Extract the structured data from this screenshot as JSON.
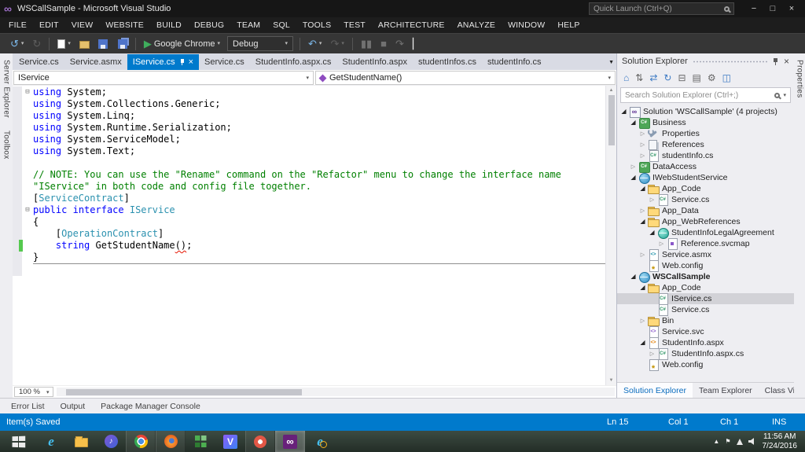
{
  "titlebar": {
    "title": "WSCallSample - Microsoft Visual Studio",
    "quick_launch_placeholder": "Quick Launch (Ctrl+Q)",
    "window_buttons": [
      {
        "name": "minimize-button",
        "glyph": "−"
      },
      {
        "name": "maximize-button",
        "glyph": "□"
      },
      {
        "name": "close-button",
        "glyph": "×"
      }
    ]
  },
  "menubar": {
    "items": [
      "FILE",
      "EDIT",
      "VIEW",
      "WEBSITE",
      "BUILD",
      "DEBUG",
      "TEAM",
      "SQL",
      "TOOLS",
      "TEST",
      "ARCHITECTURE",
      "ANALYZE",
      "WINDOW",
      "HELP"
    ]
  },
  "icons": {
    "back-icon": {
      "glyph": "↺",
      "color": "#7cb8ea"
    },
    "forward-icon": {
      "glyph": "↻",
      "color": "#9a9a9a"
    },
    "play-icon": {
      "glyph": "▶",
      "color": "#3fae5c"
    },
    "undo-icon": {
      "glyph": "↶",
      "color": "#7cb8ea"
    },
    "redo-icon": {
      "glyph": "↷",
      "color": "#9a9a9a"
    },
    "pause-icon": {
      "glyph": "▮▮",
      "color": "#c9c9c9"
    },
    "stop-icon": {
      "glyph": "■",
      "color": "#c9c9c9"
    },
    "step-icon": {
      "glyph": "↷",
      "color": "#c9c9c9"
    },
    "cursor-icon": {
      "glyph": "▏",
      "color": "#e8e8e8"
    }
  },
  "toolbar": {
    "items": [
      {
        "kind": "btn",
        "name": "navigate-backward-button",
        "icon": "back-icon",
        "caret": true
      },
      {
        "kind": "btn",
        "name": "navigate-forward-button",
        "icon": "forward-icon",
        "dim": true
      },
      {
        "kind": "sep"
      },
      {
        "kind": "btn",
        "name": "new-file-button",
        "icon": "new-file-icon",
        "caret": true
      },
      {
        "kind": "btn",
        "name": "open-file-button",
        "icon": "open-file-icon"
      },
      {
        "kind": "btn",
        "name": "save-button",
        "icon": "save-icon"
      },
      {
        "kind": "btn",
        "name": "save-all-button",
        "icon": "save-all-icon"
      },
      {
        "kind": "sep"
      },
      {
        "kind": "btn",
        "name": "start-debug-button",
        "icon": "play-icon",
        "label": "Google Chrome",
        "caret": true
      },
      {
        "kind": "combo",
        "name": "solution-configuration-dropdown",
        "label": "Debug"
      },
      {
        "kind": "sep"
      },
      {
        "kind": "btn",
        "name": "undo-button",
        "icon": "undo-icon",
        "caret": true
      },
      {
        "kind": "btn",
        "name": "redo-button",
        "icon": "redo-icon",
        "caret": true,
        "dim": true
      },
      {
        "kind": "sep"
      },
      {
        "kind": "btn",
        "name": "break-all-button",
        "icon": "pause-icon",
        "dim": true
      },
      {
        "kind": "btn",
        "name": "stop-debug-button",
        "icon": "stop-icon",
        "dim": true
      },
      {
        "kind": "btn",
        "name": "step-over-button",
        "icon": "step-icon",
        "dim": true
      },
      {
        "kind": "btn",
        "name": "text-cursor-button",
        "icon": "cursor-icon"
      }
    ]
  },
  "left_strip": {
    "tabs": [
      "Server Explorer",
      "Toolbox"
    ]
  },
  "right_strip": {
    "tabs": [
      "Properties"
    ]
  },
  "editor_tabs": [
    {
      "label": "Service.cs",
      "active": false
    },
    {
      "label": "Service.asmx",
      "active": false
    },
    {
      "label": "IService.cs",
      "active": true
    },
    {
      "label": "Service.cs",
      "active": false
    },
    {
      "label": "StudentInfo.aspx.cs",
      "active": false
    },
    {
      "label": "StudentInfo.aspx",
      "active": false
    },
    {
      "label": "studentInfos.cs",
      "active": false
    },
    {
      "label": "studentInfo.cs",
      "active": false
    }
  ],
  "navbar": {
    "type_name": "IService",
    "member_name": "GetStudentName()"
  },
  "code": {
    "lines": [
      {
        "fold": true,
        "tokens": [
          [
            "kw",
            "using"
          ],
          [
            "pl",
            " System;"
          ]
        ]
      },
      {
        "tokens": [
          [
            "kw",
            "using"
          ],
          [
            "pl",
            " System.Collections.Generic;"
          ]
        ]
      },
      {
        "tokens": [
          [
            "kw",
            "using"
          ],
          [
            "pl",
            " System.Linq;"
          ]
        ]
      },
      {
        "tokens": [
          [
            "kw",
            "using"
          ],
          [
            "pl",
            " System.Runtime.Serialization;"
          ]
        ]
      },
      {
        "tokens": [
          [
            "kw",
            "using"
          ],
          [
            "pl",
            " System.ServiceModel;"
          ]
        ]
      },
      {
        "tokens": [
          [
            "kw",
            "using"
          ],
          [
            "pl",
            " System.Text;"
          ]
        ]
      },
      {
        "tokens": []
      },
      {
        "tokens": [
          [
            "cm",
            "// NOTE: You can use the \"Rename\" command on the \"Refactor\" menu to change the interface name \"IService\" in both code and config file together."
          ]
        ]
      },
      {
        "tokens": [
          [
            "pl",
            "["
          ],
          [
            "ty",
            "ServiceContract"
          ],
          [
            "pl",
            "]"
          ]
        ]
      },
      {
        "fold": true,
        "tokens": [
          [
            "kw",
            "public"
          ],
          [
            "pl",
            " "
          ],
          [
            "kw",
            "interface"
          ],
          [
            "pl",
            " "
          ],
          [
            "ty",
            "IService"
          ]
        ]
      },
      {
        "tokens": [
          [
            "pl",
            "{"
          ]
        ]
      },
      {
        "tokens": [
          [
            "pl",
            "    ["
          ],
          [
            "ty",
            "OperationContract"
          ],
          [
            "pl",
            "]"
          ]
        ]
      },
      {
        "changed": true,
        "tokens": [
          [
            "pl",
            "    "
          ],
          [
            "kw",
            "string"
          ],
          [
            "pl",
            " GetStudentName"
          ],
          [
            "sq",
            "()"
          ],
          [
            "pl",
            ";"
          ]
        ]
      },
      {
        "tokens": [
          [
            "pl",
            "}"
          ]
        ]
      },
      {
        "hr": true,
        "tokens": []
      }
    ]
  },
  "zoom_level": "100 %",
  "bottom_panel_tabs": [
    "Error List",
    "Output",
    "Package Manager Console"
  ],
  "solution_explorer": {
    "title": "Solution Explorer",
    "search_placeholder": "Search Solution Explorer (Ctrl+;)",
    "toolbar_icons": [
      {
        "name": "home-icon",
        "glyph": "⌂",
        "color": "#3e7bc4"
      },
      {
        "name": "switch-views-icon",
        "glyph": "⇅",
        "color": "#666666"
      },
      {
        "name": "sync-with-active-document-icon",
        "glyph": "⇄",
        "color": "#3e7bc4"
      },
      {
        "name": "refresh-icon",
        "glyph": "↻",
        "color": "#3e7bc4"
      },
      {
        "name": "collapse-all-icon",
        "glyph": "⊟",
        "color": "#666666"
      },
      {
        "name": "show-all-files-icon",
        "glyph": "▤",
        "color": "#666666"
      },
      {
        "name": "properties-icon",
        "glyph": "⚙",
        "color": "#666666"
      },
      {
        "name": "preview-selected-items-icon",
        "glyph": "◫",
        "color": "#3e7bc4"
      }
    ],
    "tree": [
      {
        "level": 0,
        "arrow": "exp",
        "icon": "solution-icon",
        "label": "Solution 'WSCallSample' (4 projects)"
      },
      {
        "level": 1,
        "arrow": "exp",
        "icon": "csproj-icon",
        "label": "Business"
      },
      {
        "level": 2,
        "arrow": "col",
        "icon": "properties-node-icon",
        "label": "Properties"
      },
      {
        "level": 2,
        "arrow": "col",
        "icon": "references-icon",
        "label": "References"
      },
      {
        "level": 2,
        "arrow": "col",
        "icon": "csharp-file-icon",
        "label": "studentInfo.cs"
      },
      {
        "level": 1,
        "arrow": "col",
        "icon": "csproj-icon",
        "label": "DataAccess"
      },
      {
        "level": 1,
        "arrow": "exp",
        "icon": "web-project-icon",
        "label": "IWebStudentService"
      },
      {
        "level": 2,
        "arrow": "exp",
        "icon": "folder-icon",
        "label": "App_Code"
      },
      {
        "level": 3,
        "arrow": "col",
        "icon": "csharp-file-icon",
        "label": "Service.cs"
      },
      {
        "level": 2,
        "arrow": "col",
        "icon": "folder-icon",
        "label": "App_Data"
      },
      {
        "level": 2,
        "arrow": "exp",
        "icon": "folder-icon",
        "label": "App_WebReferences"
      },
      {
        "level": 3,
        "arrow": "exp",
        "icon": "web-reference-icon",
        "label": "StudentInfoLegalAgreement"
      },
      {
        "level": 4,
        "arrow": "col",
        "icon": "svcmap-file-icon",
        "label": "Reference.svcmap"
      },
      {
        "level": 2,
        "arrow": "col",
        "icon": "asmx-file-icon",
        "label": "Service.asmx"
      },
      {
        "level": 2,
        "icon": "config-file-icon",
        "label": "Web.config"
      },
      {
        "level": 1,
        "arrow": "exp",
        "icon": "web-project-icon",
        "label": "WSCallSample",
        "bold": true
      },
      {
        "level": 2,
        "arrow": "exp",
        "icon": "folder-icon",
        "label": "App_Code"
      },
      {
        "level": 3,
        "icon": "csharp-file-icon",
        "label": "IService.cs",
        "selected": true
      },
      {
        "level": 3,
        "icon": "csharp-file-icon",
        "label": "Service.cs"
      },
      {
        "level": 2,
        "arrow": "col",
        "icon": "folder-icon",
        "label": "Bin"
      },
      {
        "level": 2,
        "icon": "svc-file-icon",
        "label": "Service.svc"
      },
      {
        "level": 2,
        "arrow": "exp",
        "icon": "aspx-file-icon",
        "label": "StudentInfo.aspx"
      },
      {
        "level": 3,
        "arrow": "col",
        "icon": "csharp-file-icon",
        "label": "StudentInfo.aspx.cs"
      },
      {
        "level": 2,
        "icon": "config-file-icon",
        "label": "Web.config"
      }
    ],
    "footer_tabs": [
      {
        "label": "Solution Explorer",
        "active": true
      },
      {
        "label": "Team Explorer",
        "active": false
      },
      {
        "label": "Class View",
        "active": false
      }
    ]
  },
  "statusbar": {
    "message": "Item(s) Saved",
    "line": "Ln 15",
    "column": "Col 1",
    "character": "Ch 1",
    "mode": "INS"
  },
  "taskbar": {
    "apps": [
      {
        "name": "internet-explorer-icon",
        "state": ""
      },
      {
        "name": "file-explorer-icon",
        "state": ""
      },
      {
        "name": "media-app-icon",
        "state": ""
      },
      {
        "name": "chrome-icon",
        "state": "running"
      },
      {
        "name": "firefox-icon",
        "state": "running"
      },
      {
        "name": "green-grid-app-icon",
        "state": ""
      },
      {
        "name": "v-app-icon",
        "state": ""
      },
      {
        "name": "browser-app-icon",
        "state": "running"
      },
      {
        "name": "visual-studio-icon",
        "state": "active"
      },
      {
        "name": "ie-tools-icon",
        "state": ""
      }
    ],
    "tray_icons": [
      {
        "name": "show-hidden-icons-icon",
        "glyph": "▲"
      },
      {
        "name": "action-center-icon",
        "glyph": "⚑"
      },
      {
        "name": "network-icon",
        "glyph": ""
      },
      {
        "name": "volume-icon",
        "glyph": ""
      }
    ],
    "clock_time": "11:56 AM",
    "clock_date": "7/24/2016"
  },
  "colors": {
    "accent": "#007acc",
    "keyword": "#0000ff",
    "type_name": "#2b91af",
    "comment": "#008000",
    "selection": "#d2d2d7",
    "status_bar": "#007acc",
    "change_bar": "#55c94f"
  }
}
